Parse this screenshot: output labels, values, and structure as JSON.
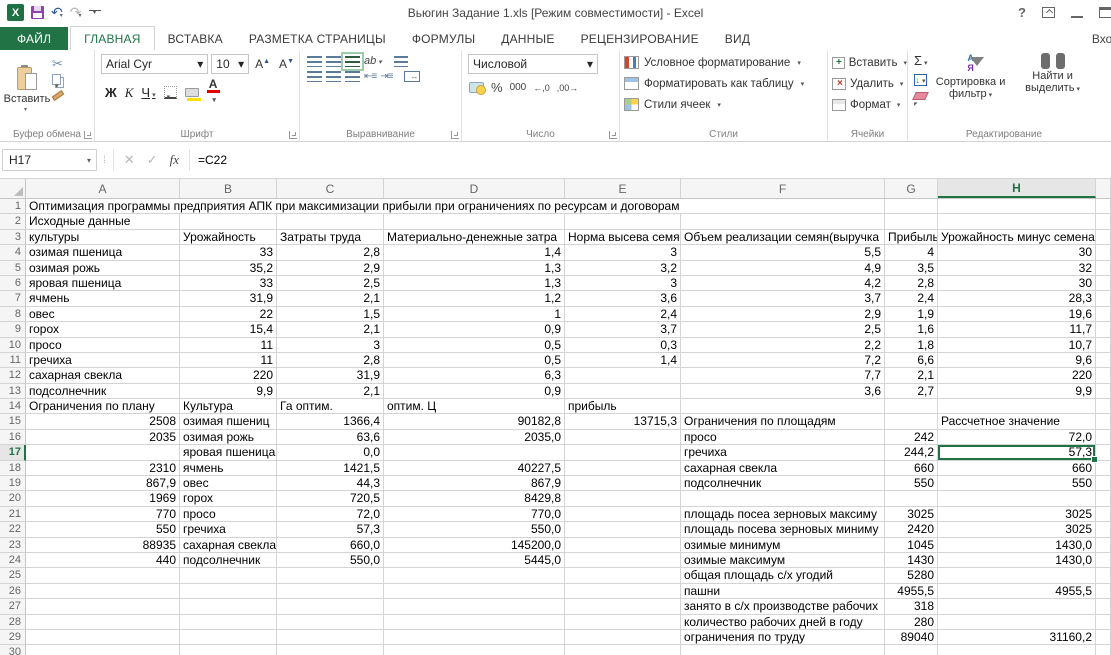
{
  "window": {
    "title": "Вьюгин Задание 1.xls  [Режим совместимости] - Excel",
    "help": "?",
    "signin": "Вход"
  },
  "tabs": {
    "items": [
      {
        "label": "ФАЙЛ"
      },
      {
        "label": "ГЛАВНАЯ"
      },
      {
        "label": "ВСТАВКА"
      },
      {
        "label": "РАЗМЕТКА СТРАНИЦЫ"
      },
      {
        "label": "ФОРМУЛЫ"
      },
      {
        "label": "ДАННЫЕ"
      },
      {
        "label": "РЕЦЕНЗИРОВАНИЕ"
      },
      {
        "label": "ВИД"
      }
    ],
    "active_tab": "ГЛАВНАЯ"
  },
  "ribbon": {
    "clipboard": {
      "group_label": "Буфер обмена",
      "paste_label": "Вставить"
    },
    "font": {
      "group_label": "Шрифт",
      "font_name": "Arial Cyr",
      "font_size": "10",
      "bold_label": "Ж",
      "italic_label": "К",
      "underline_label": "Ч",
      "grow_label": "А",
      "shrink_label": "А",
      "font_color_label": "А"
    },
    "alignment": {
      "group_label": "Выравнивание",
      "orientation_label": "ab"
    },
    "number": {
      "group_label": "Число",
      "format_value": "Числовой",
      "percent_label": "%",
      "thousands_label": "000",
      "inc_decimal_label": "←,0",
      "dec_decimal_label": ",00→"
    },
    "styles": {
      "group_label": "Стили",
      "items": [
        "Условное форматирование",
        "Форматировать как таблицу",
        "Стили ячеек"
      ]
    },
    "cells": {
      "group_label": "Ячейки",
      "items": [
        "Вставить",
        "Удалить",
        "Формат"
      ]
    },
    "editing": {
      "group_label": "Редактирование",
      "sort_label": "Сортировка и фильтр",
      "find_label": "Найти и выделить"
    }
  },
  "formula_bar": {
    "name_box": "H17",
    "fx": "fx",
    "formula": "=C22"
  },
  "grid": {
    "columns": [
      "A",
      "B",
      "C",
      "D",
      "E",
      "F",
      "G",
      "H"
    ],
    "selection": {
      "cell": "H17",
      "row": 17,
      "column": "H"
    },
    "rows": [
      {
        "n": 1,
        "spill": true,
        "cells": [
          "Оптимизация программы предприятия АПК при максимизации прибыли при ограничениях по ресурсам и договорам",
          "",
          "",
          "",
          "",
          "",
          "",
          ""
        ]
      },
      {
        "n": 2,
        "cells": [
          "Исходные данные",
          "",
          "",
          "",
          "",
          "",
          "",
          ""
        ]
      },
      {
        "n": 3,
        "cells": [
          "культуры",
          "Урожайность",
          "Затраты труда",
          "Материально-денежные затра",
          "Норма высева семя",
          "Объем реализации семян(выручка",
          "Прибыль",
          "Урожайность минус семена"
        ]
      },
      {
        "n": 4,
        "cells": [
          "озимая пшеница",
          "33",
          "2,8",
          "1,4",
          "3",
          "5,5",
          "4",
          "30"
        ]
      },
      {
        "n": 5,
        "cells": [
          "озимая рожь",
          "35,2",
          "2,9",
          "1,3",
          "3,2",
          "4,9",
          "3,5",
          "32"
        ]
      },
      {
        "n": 6,
        "cells": [
          "яровая пшеница",
          "33",
          "2,5",
          "1,3",
          "3",
          "4,2",
          "2,8",
          "30"
        ]
      },
      {
        "n": 7,
        "cells": [
          "ячмень",
          "31,9",
          "2,1",
          "1,2",
          "3,6",
          "3,7",
          "2,4",
          "28,3"
        ]
      },
      {
        "n": 8,
        "cells": [
          "овес",
          "22",
          "1,5",
          "1",
          "2,4",
          "2,9",
          "1,9",
          "19,6"
        ]
      },
      {
        "n": 9,
        "cells": [
          "горох",
          "15,4",
          "2,1",
          "0,9",
          "3,7",
          "2,5",
          "1,6",
          "11,7"
        ]
      },
      {
        "n": 10,
        "cells": [
          "просо",
          "11",
          "3",
          "0,5",
          "0,3",
          "2,2",
          "1,8",
          "10,7"
        ]
      },
      {
        "n": 11,
        "cells": [
          "гречиха",
          "11",
          "2,8",
          "0,5",
          "1,4",
          "7,2",
          "6,6",
          "9,6"
        ]
      },
      {
        "n": 12,
        "cells": [
          "сахарная свекла",
          "220",
          "31,9",
          "6,3",
          "",
          "7,7",
          "2,1",
          "220"
        ]
      },
      {
        "n": 13,
        "cells": [
          "подсолнечник",
          "9,9",
          "2,1",
          "0,9",
          "",
          "3,6",
          "2,7",
          "9,9"
        ]
      },
      {
        "n": 14,
        "cells": [
          "Ограничения по плану",
          "Культура",
          "Га оптим.",
          "оптим. Ц",
          "прибыль",
          "",
          "",
          ""
        ]
      },
      {
        "n": 15,
        "cells": [
          "2508",
          "озимая пшениц",
          "1366,4",
          "90182,8",
          "13715,3",
          "Ограничения по площадям",
          "",
          "Рассчетное значение"
        ]
      },
      {
        "n": 16,
        "cells": [
          "2035",
          "озимая рожь",
          "63,6",
          "2035,0",
          "",
          "просо",
          "242",
          "72,0"
        ]
      },
      {
        "n": 17,
        "cells": [
          "",
          "яровая пшеница",
          "0,0",
          "",
          "",
          "гречиха",
          "244,2",
          "57,3"
        ]
      },
      {
        "n": 18,
        "cells": [
          "2310",
          "ячмень",
          "1421,5",
          "40227,5",
          "",
          "сахарная свекла",
          "660",
          "660"
        ]
      },
      {
        "n": 19,
        "cells": [
          "867,9",
          "овес",
          "44,3",
          "867,9",
          "",
          "подсолнечник",
          "550",
          "550"
        ]
      },
      {
        "n": 20,
        "cells": [
          "1969",
          "горох",
          "720,5",
          "8429,8",
          "",
          "",
          "",
          ""
        ]
      },
      {
        "n": 21,
        "cells": [
          "770",
          "просо",
          "72,0",
          "770,0",
          "",
          "площадь посеа зерновых максиму",
          "3025",
          "3025"
        ]
      },
      {
        "n": 22,
        "cells": [
          "550",
          "гречиха",
          "57,3",
          "550,0",
          "",
          "площадь посева зерновых миниму",
          "2420",
          "3025"
        ]
      },
      {
        "n": 23,
        "cells": [
          "88935",
          "сахарная свекла",
          "660,0",
          "145200,0",
          "",
          "озимые минимум",
          "1045",
          "1430,0"
        ]
      },
      {
        "n": 24,
        "cells": [
          "440",
          "подсолнечник",
          "550,0",
          "5445,0",
          "",
          "озимые максимум",
          "1430",
          "1430,0"
        ]
      },
      {
        "n": 25,
        "cells": [
          "",
          "",
          "",
          "",
          "",
          "общая площадь с/х угодий",
          "5280",
          ""
        ]
      },
      {
        "n": 26,
        "cells": [
          "",
          "",
          "",
          "",
          "",
          "пашни",
          "4955,5",
          "4955,5"
        ]
      },
      {
        "n": 27,
        "cells": [
          "",
          "",
          "",
          "",
          "",
          "занято в с/х производстве рабочих",
          "318",
          ""
        ]
      },
      {
        "n": 28,
        "cells": [
          "",
          "",
          "",
          "",
          "",
          "количество рабочих дней в году",
          "280",
          ""
        ]
      },
      {
        "n": 29,
        "cells": [
          "",
          "",
          "",
          "",
          "",
          "ограничения по труду",
          "89040",
          "31160,2"
        ]
      },
      {
        "n": 30,
        "cells": [
          "",
          "",
          "",
          "",
          "",
          "",
          "",
          ""
        ]
      }
    ]
  }
}
